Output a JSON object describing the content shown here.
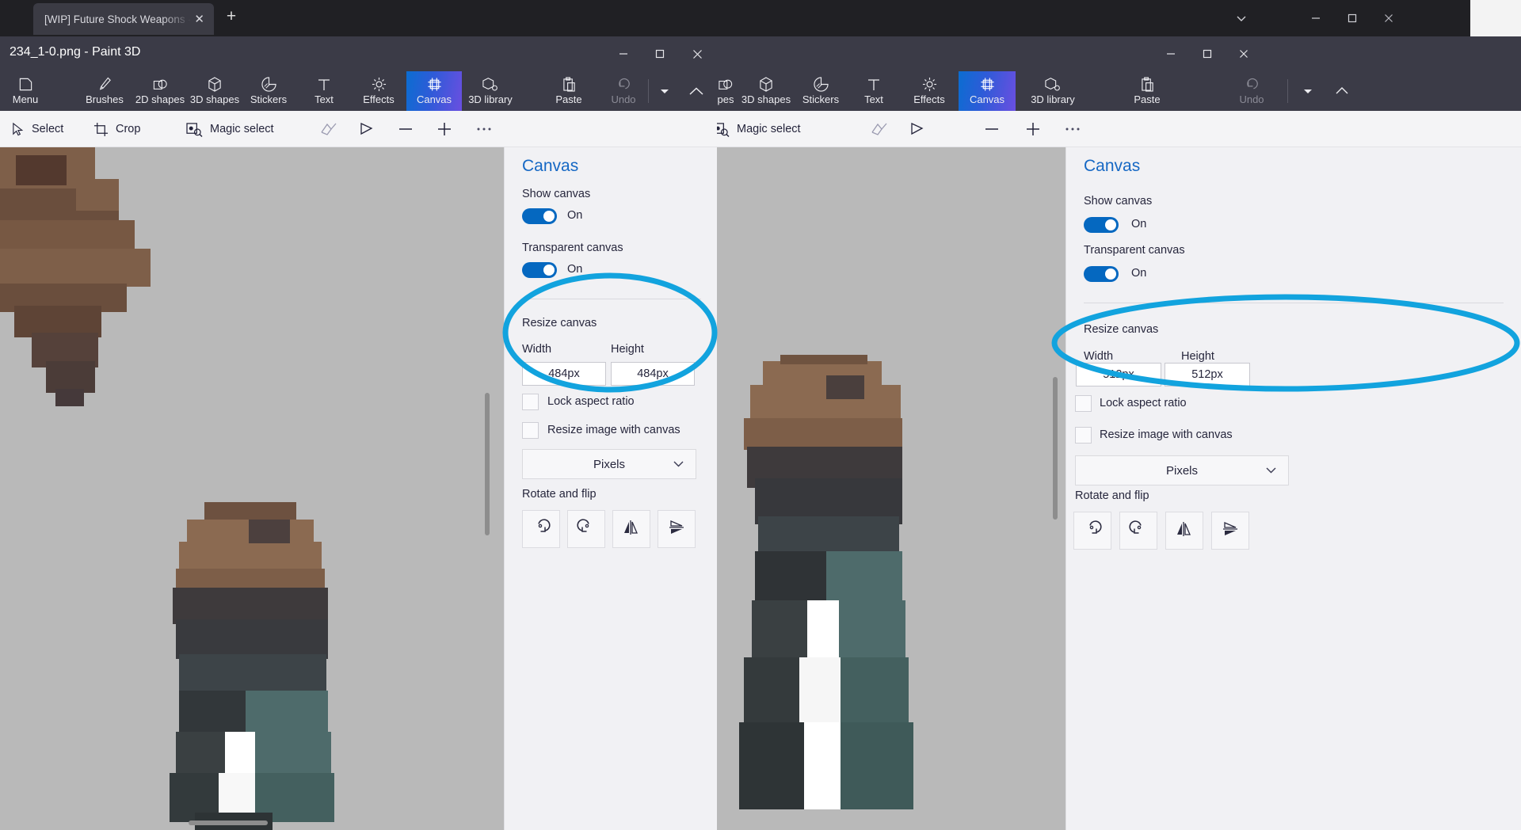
{
  "browser": {
    "tab_title": "[WIP] Future Shock Weapons - Page",
    "tab_close_icon": "close-icon",
    "new_tab_icon": "plus-icon",
    "chevron_icon": "chevron-down-icon",
    "minimize_icon": "minimize-icon",
    "maximize_icon": "maximize-icon",
    "close_icon": "close-icon"
  },
  "outer_right": {
    "maximize_icon": "maximize-icon",
    "close_icon": "close-icon",
    "help_icon": "help-icon"
  },
  "window_left": {
    "title": "234_1-0.png - Paint 3D",
    "minimize_icon": "minimize-icon",
    "maximize_icon": "maximize-icon",
    "close_icon": "close-icon",
    "ribbon": [
      {
        "label": "Menu",
        "icon": "menu-page-icon",
        "active": false,
        "dim": false
      },
      {
        "label": "Brushes",
        "icon": "brush-icon",
        "active": false,
        "dim": false
      },
      {
        "label": "2D shapes",
        "icon": "2d-shapes-icon",
        "active": false,
        "dim": false
      },
      {
        "label": "3D shapes",
        "icon": "3d-shapes-icon",
        "active": false,
        "dim": false
      },
      {
        "label": "Stickers",
        "icon": "sticker-icon",
        "active": false,
        "dim": false
      },
      {
        "label": "Text",
        "icon": "text-icon",
        "active": false,
        "dim": false
      },
      {
        "label": "Effects",
        "icon": "effects-icon",
        "active": false,
        "dim": false
      },
      {
        "label": "Canvas",
        "icon": "canvas-icon",
        "active": true,
        "dim": false
      },
      {
        "label": "3D library",
        "icon": "3d-library-icon",
        "active": false,
        "dim": false
      },
      {
        "label": "Paste",
        "icon": "paste-icon",
        "active": false,
        "dim": false
      },
      {
        "label": "Undo",
        "icon": "undo-icon",
        "active": false,
        "dim": true
      }
    ],
    "ribbon_extra": {
      "dropdown_icon": "caret-down-icon",
      "collapse_icon": "chevron-up-icon"
    },
    "subbar": [
      {
        "label": "Select",
        "icon": "cursor-select-icon"
      },
      {
        "label": "Crop",
        "icon": "crop-icon"
      },
      {
        "label": "Magic select",
        "icon": "magic-select-icon"
      }
    ],
    "subbar_tools": [
      {
        "label": "",
        "icon": "3d-view-icon"
      },
      {
        "label": "",
        "icon": "2d-view-icon"
      },
      {
        "label": "",
        "icon": "zoom-out-icon"
      },
      {
        "label": "",
        "icon": "zoom-in-icon"
      },
      {
        "label": "",
        "icon": "more-options-icon"
      }
    ],
    "panel": {
      "title": "Canvas",
      "show_canvas_label": "Show canvas",
      "show_canvas_state": "On",
      "transparent_canvas_label": "Transparent canvas",
      "transparent_canvas_state": "On",
      "resize_canvas_label": "Resize canvas",
      "width_label": "Width",
      "height_label": "Height",
      "width_value": "484px",
      "height_value": "484px",
      "lock_aspect_label": "Lock aspect ratio",
      "lock_aspect_checked": false,
      "resize_image_label": "Resize image with canvas",
      "resize_image_checked": false,
      "units_value": "Pixels",
      "rotate_flip_label": "Rotate and flip",
      "rotate_flip_buttons": [
        {
          "icon": "rotate-left-icon"
        },
        {
          "icon": "rotate-right-icon"
        },
        {
          "icon": "flip-horizontal-icon"
        },
        {
          "icon": "flip-vertical-icon"
        }
      ]
    }
  },
  "window_right": {
    "minimize_icon": "minimize-icon",
    "maximize_icon": "maximize-icon",
    "close_icon": "close-icon",
    "ribbon": [
      {
        "label": "pes",
        "icon": "",
        "active": false,
        "dim": false
      },
      {
        "label": "3D shapes",
        "icon": "3d-shapes-icon",
        "active": false,
        "dim": false
      },
      {
        "label": "Stickers",
        "icon": "sticker-icon",
        "active": false,
        "dim": false
      },
      {
        "label": "Text",
        "icon": "text-icon",
        "active": false,
        "dim": false
      },
      {
        "label": "Effects",
        "icon": "effects-icon",
        "active": false,
        "dim": false
      },
      {
        "label": "Canvas",
        "icon": "canvas-icon",
        "active": true,
        "dim": false
      },
      {
        "label": "3D library",
        "icon": "3d-library-icon",
        "active": false,
        "dim": false
      },
      {
        "label": "Paste",
        "icon": "paste-icon",
        "active": false,
        "dim": false
      },
      {
        "label": "Undo",
        "icon": "undo-icon",
        "active": false,
        "dim": true
      }
    ],
    "subbar": [
      {
        "label": "Magic select",
        "icon": "magic-select-icon"
      }
    ],
    "subbar_tools": [
      {
        "label": "",
        "icon": "3d-view-icon"
      },
      {
        "label": "",
        "icon": "2d-view-icon"
      },
      {
        "label": "",
        "icon": "zoom-out-icon"
      },
      {
        "label": "",
        "icon": "zoom-in-icon"
      },
      {
        "label": "",
        "icon": "more-options-icon"
      }
    ],
    "panel": {
      "title": "Canvas",
      "show_canvas_label": "Show canvas",
      "show_canvas_state": "On",
      "transparent_canvas_label": "Transparent canvas",
      "transparent_canvas_state": "On",
      "resize_canvas_label": "Resize canvas",
      "width_label": "Width",
      "height_label": "Height",
      "width_value": "512px",
      "height_value": "512px",
      "lock_aspect_label": "Lock aspect ratio",
      "lock_aspect_checked": false,
      "resize_image_label": "Resize image with canvas",
      "resize_image_checked": false,
      "units_value": "Pixels",
      "rotate_flip_label": "Rotate and flip",
      "rotate_flip_buttons": [
        {
          "icon": "rotate-left-icon"
        },
        {
          "icon": "rotate-right-icon"
        },
        {
          "icon": "flip-horizontal-icon"
        },
        {
          "icon": "flip-vertical-icon"
        }
      ]
    }
  },
  "annotations": {
    "color": "#12a3de",
    "items": [
      {
        "name": "highlight-ellipse-left",
        "target": "resize-canvas-fields-484"
      },
      {
        "name": "highlight-ellipse-right",
        "target": "resize-canvas-fields-512"
      }
    ]
  },
  "colors": {
    "accent_blue": "#0568c0",
    "ribbon_dark": "#3b3b47",
    "panel_bg": "#f1f1f4",
    "canvas_gray": "#b9b9b9",
    "annotation": "#12a3de",
    "figure_brown": "#8a6a52",
    "figure_dark": "#3e3a3c",
    "figure_teal": "#4e6b6b"
  }
}
